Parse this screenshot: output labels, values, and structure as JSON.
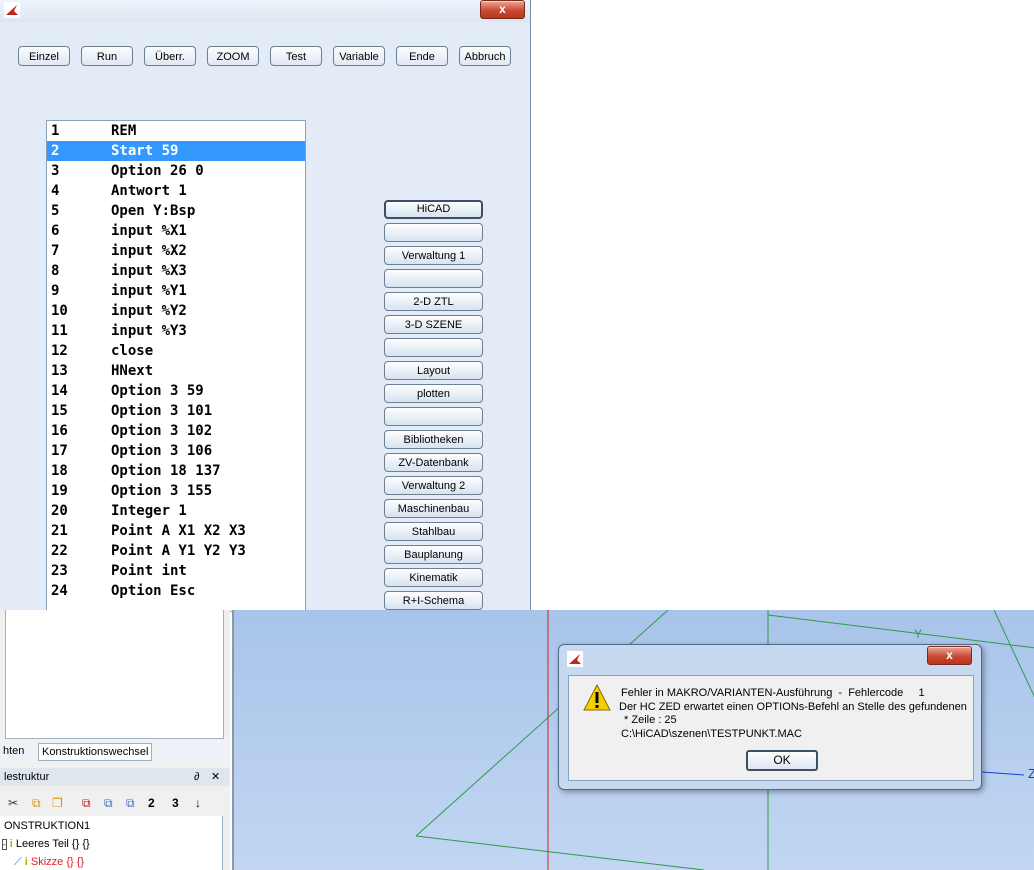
{
  "macro_window": {
    "close_label": "x",
    "toolbar": [
      "Einzel",
      "Run",
      "Überr.",
      "ZOOM",
      "Test",
      "Variable",
      "Ende",
      "Abbruch"
    ],
    "code_lines": [
      {
        "n": "1",
        "text": "REM"
      },
      {
        "n": "2",
        "text": "Start 59"
      },
      {
        "n": "3",
        "text": "Option 26 0"
      },
      {
        "n": "4",
        "text": "Antwort 1"
      },
      {
        "n": "5",
        "text": "Open Y:Bsp"
      },
      {
        "n": "6",
        "text": "input %X1"
      },
      {
        "n": "7",
        "text": "input %X2"
      },
      {
        "n": "8",
        "text": "input %X3"
      },
      {
        "n": "9",
        "text": "input %Y1"
      },
      {
        "n": "10",
        "text": "input %Y2"
      },
      {
        "n": "11",
        "text": "input %Y3"
      },
      {
        "n": "12",
        "text": "close"
      },
      {
        "n": "13",
        "text": "HNext"
      },
      {
        "n": "14",
        "text": "Option 3 59"
      },
      {
        "n": "15",
        "text": "Option 3 101"
      },
      {
        "n": "16",
        "text": "Option 3 102"
      },
      {
        "n": "17",
        "text": "Option 3 106"
      },
      {
        "n": "18",
        "text": "Option 18 137"
      },
      {
        "n": "19",
        "text": "Option 3 155"
      },
      {
        "n": "20",
        "text": "Integer 1"
      },
      {
        "n": "21",
        "text": "Point A X1 X2 X3"
      },
      {
        "n": "22",
        "text": "Point A Y1 Y2 Y3"
      },
      {
        "n": "23",
        "text": "Point int"
      },
      {
        "n": "24",
        "text": "Option Esc"
      }
    ],
    "selected_line": "2",
    "menu_buttons": [
      "HiCAD",
      "",
      "Verwaltung 1",
      "",
      "2-D ZTL",
      "3-D SZENE",
      "",
      "Layout",
      "plotten",
      "",
      "Bibliotheken",
      "ZV-Datenbank",
      "Verwaltung 2",
      "Maschinenbau",
      "Stahlbau",
      "Bauplanung",
      "Kinematik",
      "R+I-Schema"
    ]
  },
  "left_panel": {
    "tabs": [
      "hten",
      "Konstruktionswechsel"
    ],
    "tree_title": "lestruktur",
    "pin": "∂",
    "close": "✕",
    "toolbar_labels": [
      "✂",
      "⧉",
      "❐",
      "⧉",
      "⧉",
      "⧉",
      "│",
      "↓"
    ],
    "toolbar_nums": [
      "2",
      "3"
    ],
    "tree": {
      "root": "ONSTRUKTION1",
      "part": "Leeres Teil {} {}",
      "sketch": "Skizze {} {}"
    }
  },
  "viewport": {
    "axis_label_x": "Z",
    "axis_label_y": "Y"
  },
  "error_dialog": {
    "close_label": "x",
    "line1": "Fehler in MAKRO/VARIANTEN-Ausführung  -  Fehlercode     1",
    "line2": "Der HC ZED erwartet einen OPTIONs-Befehl an Stelle des gefundenen",
    "line3": " * Zeile : 25",
    "line4": "C:\\HiCAD\\szenen\\TESTPUNKT.MAC",
    "ok_label": "OK"
  },
  "colors": {
    "selection": "#3399ff",
    "window_bg": "#e3ecf6",
    "viewport_bg": "#b4cdef",
    "close_red": "#c94a33",
    "line_green": "#2e9a4a",
    "line_red": "#cc2222",
    "line_blue": "#1a3ccc"
  }
}
